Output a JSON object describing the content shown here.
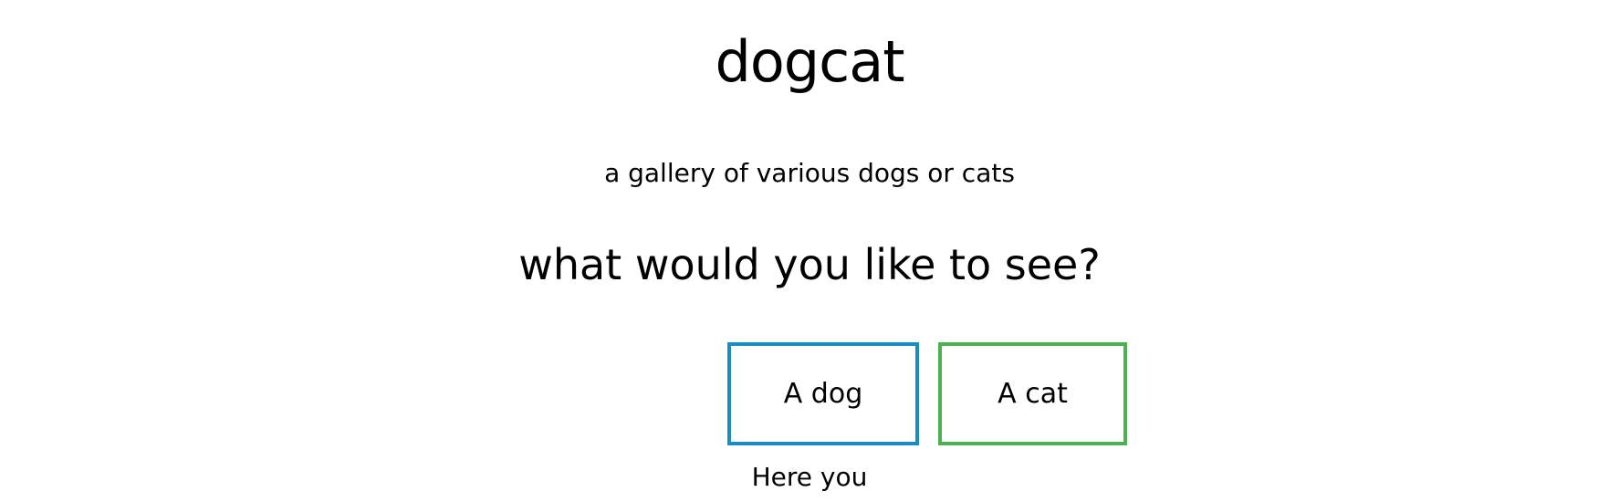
{
  "header": {
    "title": "dogcat",
    "subtitle": "a gallery of various dogs or cats"
  },
  "main": {
    "question": "what would you like to see?",
    "buttons": [
      {
        "label": "A dog",
        "border_color": "#1a8bc3"
      },
      {
        "label": "A cat",
        "border_color": "#4caf50"
      }
    ],
    "result_text": "Here you"
  }
}
